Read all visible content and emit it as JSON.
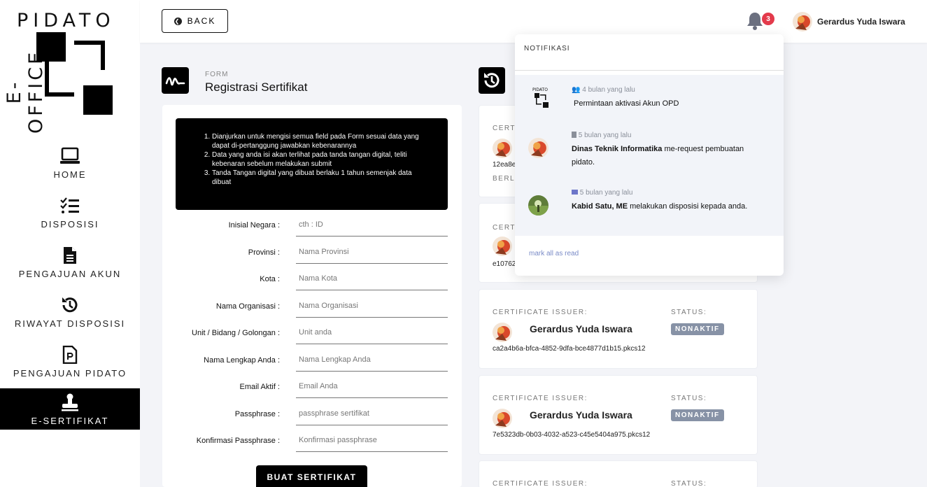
{
  "brand": {
    "top": "PIDATO",
    "side": "E-OFFICE"
  },
  "nav": [
    {
      "label": "HOME",
      "icon": "laptop-icon"
    },
    {
      "label": "DISPOSISI",
      "icon": "checklist-icon"
    },
    {
      "label": "PENGAJUAN AKUN",
      "icon": "document-icon"
    },
    {
      "label": "RIWAYAT DISPOSISI",
      "icon": "history-icon"
    },
    {
      "label": "PENGAJUAN PIDATO",
      "icon": "file-p-icon"
    },
    {
      "label": "E-SERTIFIKAT",
      "icon": "stamp-icon",
      "active": true
    }
  ],
  "header": {
    "back_label": "BACK",
    "notif_count": "3",
    "user_name": "Gerardus Yuda Iswara"
  },
  "form": {
    "eyebrow": "FORM",
    "title": "Registrasi Sertifikat",
    "notice": [
      "Dianjurkan untuk mengisi semua field pada Form sesuai data yang dapat di-pertanggung jawabkan kebenarannya",
      "Data yang anda isi akan terlihat pada tanda tangan digital, teliti kebenaran sebelum melakukan submit",
      "Tanda Tangan digital yang dibuat berlaku 1 tahun semenjak data dibuat"
    ],
    "fields": [
      {
        "label": "Inisial Negara :",
        "placeholder": "cth : ID"
      },
      {
        "label": "Provinsi :",
        "placeholder": "Nama Provinsi"
      },
      {
        "label": "Kota :",
        "placeholder": "Nama Kota"
      },
      {
        "label": "Nama Organisasi :",
        "placeholder": "Nama Organisasi"
      },
      {
        "label": "Unit / Bidang / Golongan :",
        "placeholder": "Unit anda"
      },
      {
        "label": "Nama Lengkap Anda :",
        "placeholder": "Nama Lengkap Anda"
      },
      {
        "label": "Email Aktif :",
        "placeholder": "Email Anda"
      },
      {
        "label": "Passphrase :",
        "placeholder": "passphrase sertifikat"
      },
      {
        "label": "Konfirmasi Passphrase :",
        "placeholder": "Konfirmasi passphrase"
      }
    ],
    "submit_label": "BUAT SERTIFIKAT"
  },
  "certificates": {
    "issuer_label": "CERTIFICATE ISSUER:",
    "status_label": "STATUS:",
    "partial": [
      {
        "eyebrow": "CERTIF",
        "file": "12ea8e",
        "extra": "BERLA"
      },
      {
        "eyebrow": "CERTIF",
        "file": "e10762"
      }
    ],
    "items": [
      {
        "issuer": "Gerardus Yuda Iswara",
        "status": "NONAKTIF",
        "file": "ca2a4b6a-bfca-4852-9dfa-bce4877d1b15.pkcs12"
      },
      {
        "issuer": "Gerardus Yuda Iswara",
        "status": "NONAKTIF",
        "file": "7e5323db-0b03-4032-a523-c45e5404a975.pkcs12"
      }
    ],
    "last_issuer_label": "CERTIFICATE ISSUER:",
    "last_status_label": "STATUS:"
  },
  "notifications": {
    "title": "NOTIFIKASI",
    "items": [
      {
        "icon": "users-icon",
        "time": "4 bulan yang lalu",
        "bold": "",
        "text": "Permintaan aktivasi Akun OPD"
      },
      {
        "icon": "file-icon",
        "time": "5 bulan yang lalu",
        "bold": "Dinas Teknik Informatika",
        "text": " me-request pembuatan pidato."
      },
      {
        "icon": "envelope-icon",
        "time": "5 bulan yang lalu",
        "bold": "Kabid Satu, ME",
        "text": " melakukan disposisi kepada anda."
      }
    ],
    "mark_all": "mark all as read"
  },
  "colors": {
    "accent": "#000000",
    "badge": "#e33a4b",
    "status_nonaktif": "#8792a6",
    "link": "#7a8bc7"
  }
}
